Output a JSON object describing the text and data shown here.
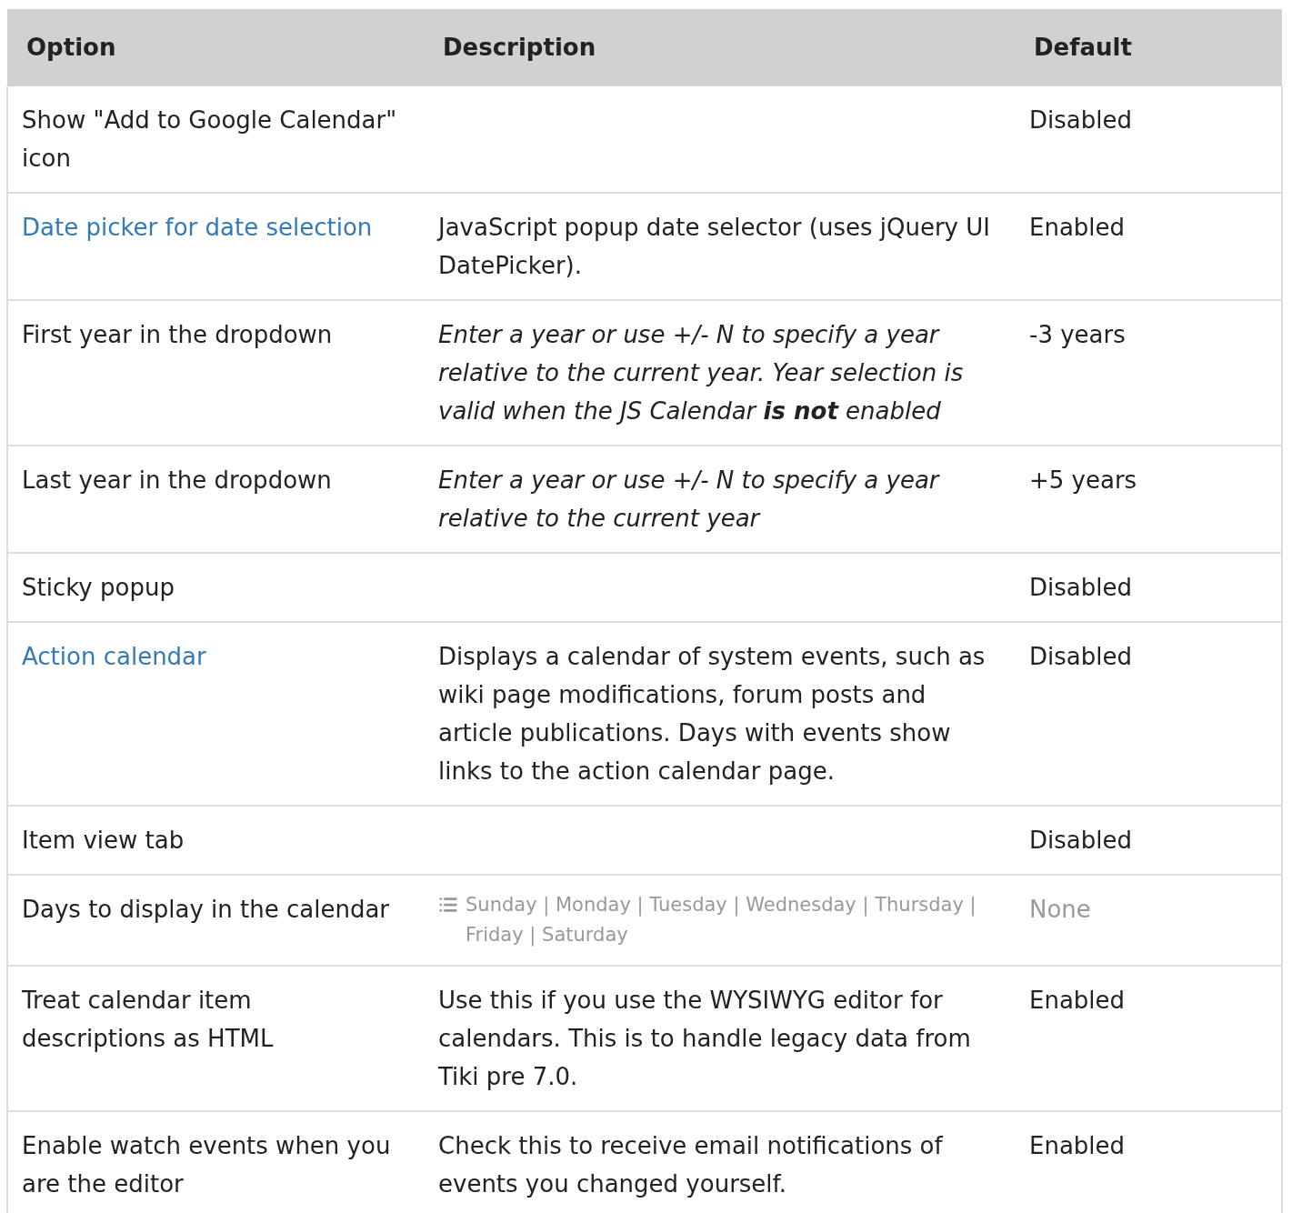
{
  "table": {
    "columns": [
      "Option",
      "Description",
      "Default"
    ],
    "rows": [
      {
        "option": {
          "text": "Show \"Add to Google Calendar\" icon",
          "link": false
        },
        "default": {
          "text": "Disabled",
          "muted": false
        }
      },
      {
        "option": {
          "text": "Date picker for date selection",
          "link": true
        },
        "description": {
          "kind": "plain",
          "text": "JavaScript popup date selector (uses jQuery UI DatePicker)."
        },
        "default": {
          "text": "Enabled",
          "muted": false
        }
      },
      {
        "option": {
          "text": "First year in the dropdown",
          "link": false
        },
        "description": {
          "kind": "italic",
          "text": "Enter a year or use +/- N to specify a year relative to the current year. Year selection is valid when the JS Calendar **is not** enabled"
        },
        "default": {
          "text": "-3 years",
          "muted": false
        }
      },
      {
        "option": {
          "text": "Last year in the dropdown",
          "link": false
        },
        "description": {
          "kind": "italic",
          "text": "Enter a year or use +/- N to specify a year relative to the current year"
        },
        "default": {
          "text": "+5 years",
          "muted": false
        }
      },
      {
        "option": {
          "text": "Sticky popup",
          "link": false
        },
        "default": {
          "text": "Disabled",
          "muted": false
        }
      },
      {
        "option": {
          "text": "Action calendar",
          "link": true
        },
        "description": {
          "kind": "plain",
          "text": "Displays a calendar of system events, such as wiki page modifications, forum posts and article publications. Days with events show links to the action calendar page."
        },
        "default": {
          "text": "Disabled",
          "muted": false
        }
      },
      {
        "option": {
          "text": "Item view tab",
          "link": false
        },
        "default": {
          "text": "Disabled",
          "muted": false
        }
      },
      {
        "option": {
          "text": "Days to display in the calendar",
          "link": false
        },
        "description": {
          "kind": "list",
          "text": "Sunday | Monday | Tuesday | Wednesday | Thursday | Friday | Saturday"
        },
        "default": {
          "text": "None",
          "muted": true
        }
      },
      {
        "option": {
          "text": "Treat calendar item descriptions as HTML",
          "link": false
        },
        "description": {
          "kind": "plain",
          "text": "Use this if you use the WYSIWYG editor for calendars. This is to handle legacy data from Tiki pre 7.0."
        },
        "default": {
          "text": "Enabled",
          "muted": false
        }
      },
      {
        "option": {
          "text": "Enable watch events when you are the editor",
          "link": false
        },
        "description": {
          "kind": "plain",
          "text": "Check this to receive email notifications of events you changed yourself."
        },
        "default": {
          "text": "Enabled",
          "muted": false
        }
      }
    ]
  }
}
